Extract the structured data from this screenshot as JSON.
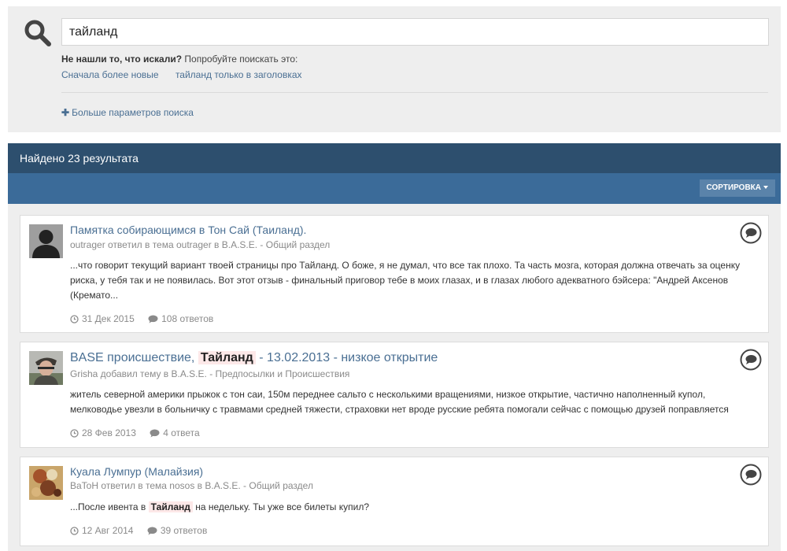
{
  "search": {
    "query": "тайланд",
    "hint_bold": "Не нашли то, что искали?",
    "hint_text": " Попробуйте поискать это:",
    "suggestion_links": [
      "Сначала более новые",
      "тайланд только в заголовках"
    ],
    "more_params_label": "Больше параметров поиска"
  },
  "results": {
    "count_label": "Найдено 23 результата",
    "sort_label": "СОРТИРОВКА",
    "items": [
      {
        "title": "Памятка собирающимся в Тон Сай (Таиланд).",
        "title_before": "",
        "title_highlight": "",
        "title_after": "",
        "meta": "outrager ответил в тема outrager в B.A.S.E. - Общий раздел",
        "text": "...что говорит текущий вариант твоей страницы про Тайланд. О боже, я не думал, что все так плохо. Та часть мозга, которая должна отвечать за оценку риска, у тебя так и не появилась. Вот этот отзыв - финальный приговор тебе в моих глазах, и в глазах любого адекватного бэйсера: \"Андрей Аксенов (Кремато...",
        "date": "31 Дек 2015",
        "replies": "108 ответов"
      },
      {
        "title_before": "BASE происшествие, ",
        "title_highlight": "Тайланд",
        "title_after": " - 13.02.2013 - низкое открытие",
        "meta": "Grisha добавил тему в B.A.S.E. - Предпосылки и Происшествия",
        "text": "житель северной америки прыжок с тон саи, 150м переднее сальто с несколькими вращениями, низкое открытие, частично наполненный купол, мелководье увезли в больничку с травмами средней тяжести, страховки нет вроде русские ребята помогали сейчас с помощью друзей поправляется",
        "date": "28 Фев 2013",
        "replies": "4 ответа"
      },
      {
        "title": "Куала Лумпур (Малайзия)",
        "meta": "BaToH ответил в тема nosos в B.A.S.E. - Общий раздел",
        "text_before": "...После ивента в ",
        "text_highlight": "Тайланд",
        "text_after": " на недельку. Ты уже все билеты купил?",
        "date": "12 Авг 2014",
        "replies": "39 ответов"
      }
    ]
  }
}
